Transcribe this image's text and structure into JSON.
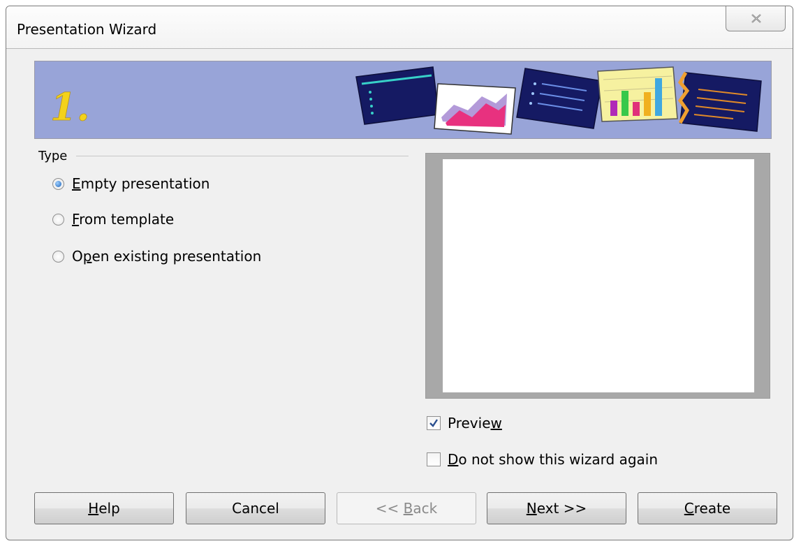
{
  "window": {
    "title": "Presentation Wizard"
  },
  "banner": {
    "step": "1."
  },
  "type_group": {
    "label": "Type",
    "options": [
      {
        "pre": "",
        "key": "E",
        "post": "mpty presentation",
        "checked": true
      },
      {
        "pre": "",
        "key": "F",
        "post": "rom template",
        "checked": false
      },
      {
        "pre": "O",
        "key": "p",
        "post": "en existing presentation",
        "checked": false
      }
    ]
  },
  "checkboxes": {
    "preview": {
      "pre": "Previe",
      "key": "w",
      "post": "",
      "checked": true
    },
    "dont_show": {
      "pre": "",
      "key": "D",
      "post": "o not show this wizard again",
      "checked": false
    }
  },
  "buttons": {
    "help": {
      "pre": "",
      "key": "H",
      "post": "elp",
      "enabled": true
    },
    "cancel": {
      "label": "Cancel",
      "enabled": true
    },
    "back": {
      "pre": "<< ",
      "key": "B",
      "post": "ack",
      "enabled": false
    },
    "next": {
      "pre": "",
      "key": "N",
      "post": "ext >>",
      "enabled": true
    },
    "create": {
      "pre": "",
      "key": "C",
      "post": "reate",
      "enabled": true
    }
  },
  "colors": {
    "banner_bg": "#98a4d8",
    "step_number": "#f3d21a",
    "radio_dot": "#1f63b8"
  }
}
